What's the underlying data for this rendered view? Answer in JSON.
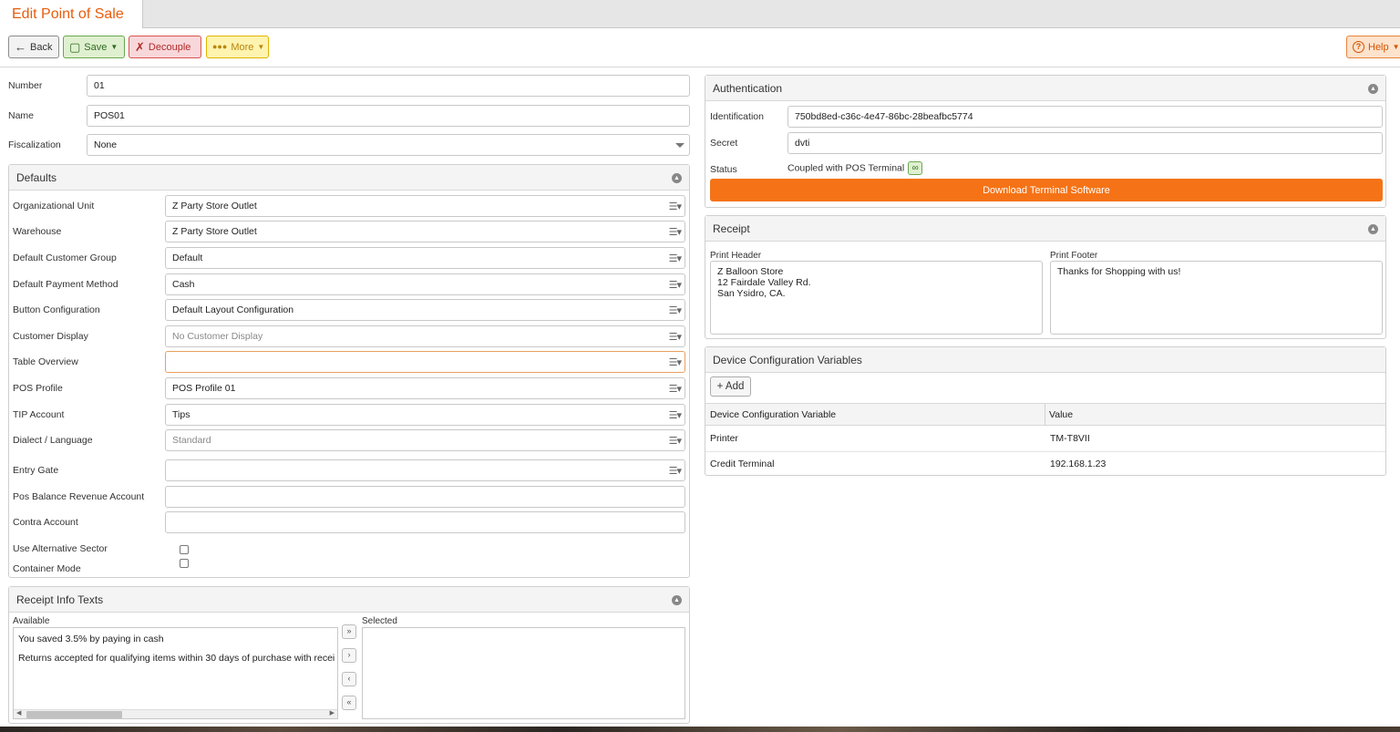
{
  "tab": {
    "title": "Edit Point of Sale"
  },
  "toolbar": {
    "back_label": "Back",
    "save_label": "Save",
    "decouple_label": "Decouple",
    "more_label": "More",
    "help_label": "Help"
  },
  "main": {
    "number": {
      "label": "Number",
      "value": "01"
    },
    "name": {
      "label": "Name",
      "value": "POS01"
    },
    "fiscalization": {
      "label": "Fiscalization",
      "value": "None"
    }
  },
  "defaults": {
    "title": "Defaults",
    "rows": [
      {
        "label": "Organizational Unit",
        "value": "Z Party Store Outlet",
        "placeholder": false
      },
      {
        "label": "Warehouse",
        "value": "Z Party Store Outlet",
        "placeholder": false
      },
      {
        "label": "Default Customer Group",
        "value": "Default",
        "placeholder": false
      },
      {
        "label": "Default Payment Method",
        "value": "Cash",
        "placeholder": false
      },
      {
        "label": "Button Configuration",
        "value": "Default Layout Configuration",
        "placeholder": false
      },
      {
        "label": "Customer Display",
        "value": "No Customer Display",
        "placeholder": true
      },
      {
        "label": "Table Overview",
        "value": "",
        "placeholder": false
      },
      {
        "label": "POS Profile",
        "value": "POS Profile 01",
        "placeholder": false
      },
      {
        "label": "TIP Account",
        "value": "Tips",
        "placeholder": false
      },
      {
        "label": "Dialect / Language",
        "value": "Standard",
        "placeholder": true
      },
      {
        "label": "Entry Gate",
        "value": "",
        "placeholder": false
      }
    ],
    "pos_balance_label": "Pos Balance Revenue Account",
    "contra_account_label": "Contra Account",
    "use_alt_sector_label": "Use Alternative Sector",
    "container_mode_label": "Container Mode"
  },
  "receipt_info": {
    "title": "Receipt Info Texts",
    "available_label": "Available",
    "selected_label": "Selected",
    "available_items": [
      "You saved 3.5% by paying in cash",
      "Returns accepted for qualifying items within 30 days of purchase with recei"
    ],
    "move_all_right": "»",
    "move_right": "›",
    "move_left": "‹",
    "move_all_left": "«"
  },
  "authentication": {
    "title": "Authentication",
    "identification_label": "Identification",
    "identification_value": "750bd8ed-c36c-4e47-86bc-28beafbc5774",
    "secret_label": "Secret",
    "secret_value": "dvti",
    "status_label": "Status",
    "status_value": "Coupled with POS Terminal",
    "download_label": "Download Terminal Software"
  },
  "receipt": {
    "title": "Receipt",
    "header_label": "Print Header",
    "header_lines": [
      "Z Balloon Store",
      "12 Fairdale Valley Rd.",
      "San Ysidro, CA."
    ],
    "footer_label": "Print Footer",
    "footer_lines": [
      "Thanks for Shopping with us!"
    ]
  },
  "device_config": {
    "title": "Device Configuration Variables",
    "add_label": "+ Add",
    "col_variable": "Device Configuration Variable",
    "col_value": "Value",
    "rows": [
      {
        "variable": "Printer",
        "value": "TM-T8VII"
      },
      {
        "variable": "Credit Terminal",
        "value": "192.168.1.23"
      }
    ]
  },
  "icons": {
    "back": "arrow-left-icon",
    "save": "floppy-icon",
    "decouple": "unlink-icon",
    "more": "dots-icon",
    "help": "question-icon",
    "selector": "list-icon",
    "collapse": "collapse-icon",
    "coupled": "link-icon"
  }
}
